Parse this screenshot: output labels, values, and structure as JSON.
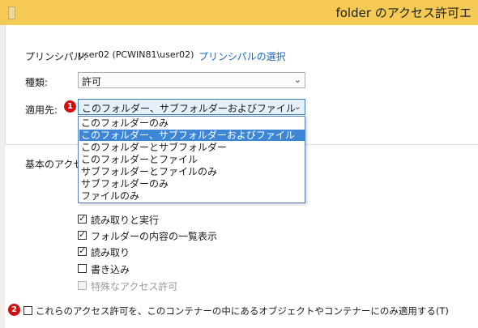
{
  "window": {
    "title": "folder のアクセス許可エ"
  },
  "principal": {
    "label": "プリンシパル:",
    "value": "user02 (PCWIN81\\user02)",
    "select_link": "プリンシパルの選択"
  },
  "type_field": {
    "label": "種類:",
    "value": "許可"
  },
  "applies_to": {
    "label": "適用先:",
    "badge": "1",
    "value": "このフォルダー、サブフォルダーおよびファイル",
    "options": [
      "このフォルダーのみ",
      "このフォルダー、サブフォルダーおよびファイル",
      "このフォルダーとサブフォルダー",
      "このフォルダーとファイル",
      "サブフォルダーとファイルのみ",
      "サブフォルダーのみ",
      "ファイルのみ"
    ],
    "selected_index": 1
  },
  "basic_permissions": {
    "label": "基本のアクセ",
    "items": [
      {
        "label": "読み取りと実行",
        "checked": true,
        "disabled": false
      },
      {
        "label": "フォルダーの内容の一覧表示",
        "checked": true,
        "disabled": false
      },
      {
        "label": "読み取り",
        "checked": true,
        "disabled": false
      },
      {
        "label": "書き込み",
        "checked": false,
        "disabled": false
      },
      {
        "label": "特殊なアクセス許可",
        "checked": false,
        "disabled": true
      }
    ]
  },
  "container_only": {
    "badge": "2",
    "label": "これらのアクセス許可を、このコンテナーの中にあるオブジェクトやコンテナーにのみ適用する(T)",
    "checked": false
  },
  "colors": {
    "title_bar": "#f4ca55",
    "selection": "#3d86d6",
    "link": "#1a66c0",
    "badge": "#d21010"
  }
}
